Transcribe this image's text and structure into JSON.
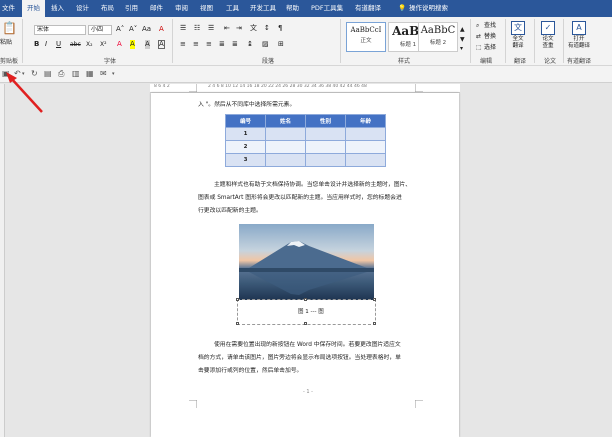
{
  "tabs": {
    "file": "文件",
    "home": "开始",
    "insert": "插入",
    "design": "设计",
    "layout": "布局",
    "references": "引用",
    "mailings": "邮件",
    "review": "审阅",
    "view": "视图",
    "tools": "工具",
    "developer": "开发工具",
    "help": "帮助",
    "pdf": "PDF工具集",
    "translate": "有道翻译",
    "tell_me": "操作说明搜索"
  },
  "ribbon": {
    "clipboard": {
      "paste": "粘贴",
      "label": "剪贴板"
    },
    "font": {
      "name": "宋体",
      "size": "小四",
      "label": "字体",
      "grow": "A˄",
      "shrink": "A˅",
      "case": "Aa",
      "clear": "A",
      "bold": "B",
      "italic": "I",
      "underline": "U",
      "strike": "abc",
      "sub": "X₂",
      "sup": "X²",
      "color": "A",
      "highlight": "A",
      "charshade": "A",
      "border": "A"
    },
    "paragraph": {
      "label": "段落"
    },
    "styles": {
      "label": "样式",
      "items": [
        {
          "preview": "AaBbCcI",
          "name": "正文"
        },
        {
          "preview": "AaBl",
          "name": "标题 1"
        },
        {
          "preview": "AaBbC",
          "name": "标题 2"
        }
      ]
    },
    "editing": {
      "find": "查找",
      "replace": "替换",
      "select": "选择",
      "label": "编辑"
    },
    "fulltext": {
      "line1": "全文",
      "line2": "翻译",
      "label": "翻译"
    },
    "paper": {
      "line1": "论文",
      "line2": "查重",
      "label": "论文"
    },
    "youdao": {
      "line1": "打开",
      "line2": "有道翻译",
      "label": "有道翻译"
    }
  },
  "qat": {
    "save": "▣",
    "undo": "↶",
    "redo": "↻"
  },
  "ruler": {
    "left": "8 6 4 2",
    "marks": "2 4 6 8 10 12 14 16 18 20 22 24 26 28 30 32 34 36 38 40 42 44 46 48"
  },
  "doc": {
    "line0": "入 \"。然后从不同库中选择所需元素。",
    "table": {
      "headers": [
        "编号",
        "姓名",
        "性别",
        "年龄"
      ],
      "rows": [
        [
          "1",
          "",
          "",
          ""
        ],
        [
          "2",
          "",
          "",
          ""
        ],
        [
          "3",
          "",
          "",
          ""
        ]
      ]
    },
    "para1": [
      "主题和样式也有助于文档保持协调。当您单击设计并选择新的主题时，图片、",
      "图表或 SmartArt 图形将会更改以匹配新的主题。当应用样式时，您的标题会进",
      "行更改以匹配新的主题。"
    ],
    "caption": "图 1 --- 图",
    "para2": [
      "使用在需要位置出现的新按钮在 Word 中保存时间。若要更改图片适应文",
      "档的方式，请单击该图片，图片旁边将会显示布局选项按钮。当处理表格时，单",
      "击要添加行或列的位置，然后单击加号。"
    ],
    "page_number": "- 1 -"
  },
  "colors": {
    "ribbon_blue": "#2b579a",
    "table_header": "#4472c4",
    "table_cell": "#d9e2f3",
    "arrow": "#e02020"
  }
}
